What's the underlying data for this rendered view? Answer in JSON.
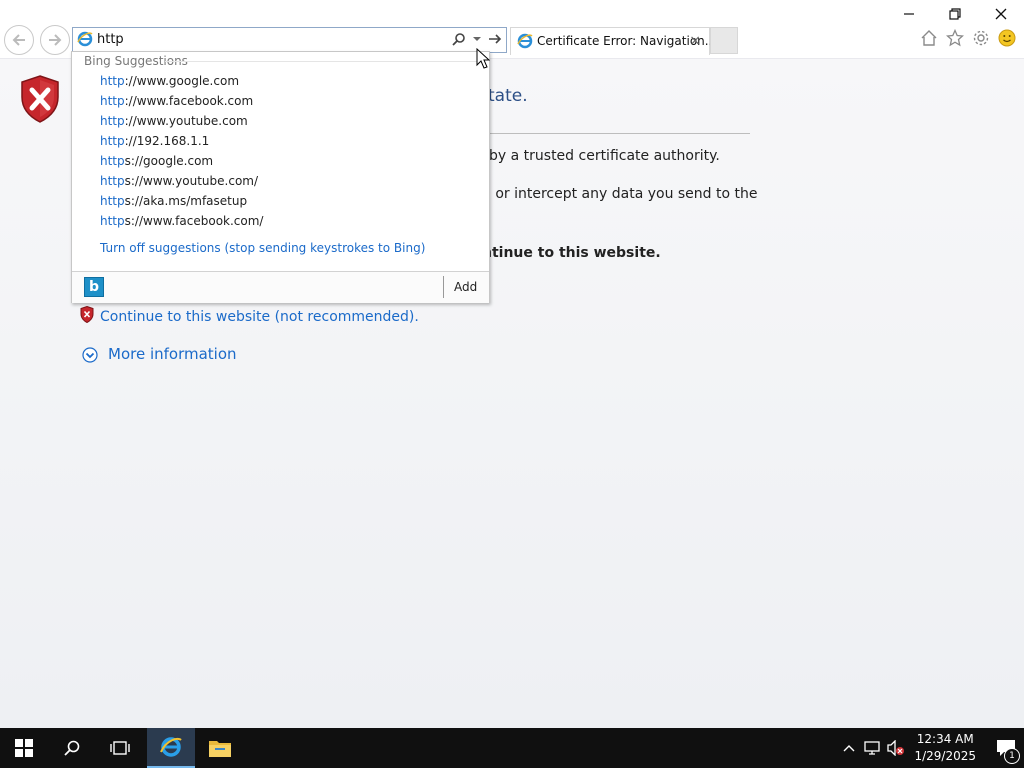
{
  "window": {
    "minimize_label": "—",
    "restore_label": "❐",
    "close_label": "✕"
  },
  "address_bar": {
    "value": "http"
  },
  "tab": {
    "title": "Certificate Error: Navigation...",
    "close_label": "×"
  },
  "page": {
    "title_fragment": "tate.",
    "line1_fragment": "by a trusted certificate authority.",
    "line2_fragment": "u or intercept any data you send to the",
    "line3_fragment": "ntinue to this website.",
    "continue_link": "Continue to this website (not recommended).",
    "more_info": "More information"
  },
  "suggestions": {
    "header": "Bing Suggestions",
    "items": [
      {
        "match": "http",
        "rest": "://www.google.com"
      },
      {
        "match": "http",
        "rest": "://www.facebook.com"
      },
      {
        "match": "http",
        "rest": "://www.youtube.com"
      },
      {
        "match": "http",
        "rest": "://192.168.1.1"
      },
      {
        "match": "http",
        "rest": "s://google.com"
      },
      {
        "match": "http",
        "rest": "s://www.youtube.com/"
      },
      {
        "match": "http",
        "rest": "s://aka.ms/mfasetup"
      },
      {
        "match": "http",
        "rest": "s://www.facebook.com/"
      }
    ],
    "turn_off": "Turn off suggestions (stop sending keystrokes to Bing)",
    "add_label": "Add",
    "bing_glyph": "b"
  },
  "taskbar": {
    "time": "12:34 AM",
    "date": "1/29/2025",
    "notification_count": "1"
  },
  "colors": {
    "link": "#1b6ac9",
    "taskbar": "#101010",
    "error_red": "#d13438"
  }
}
